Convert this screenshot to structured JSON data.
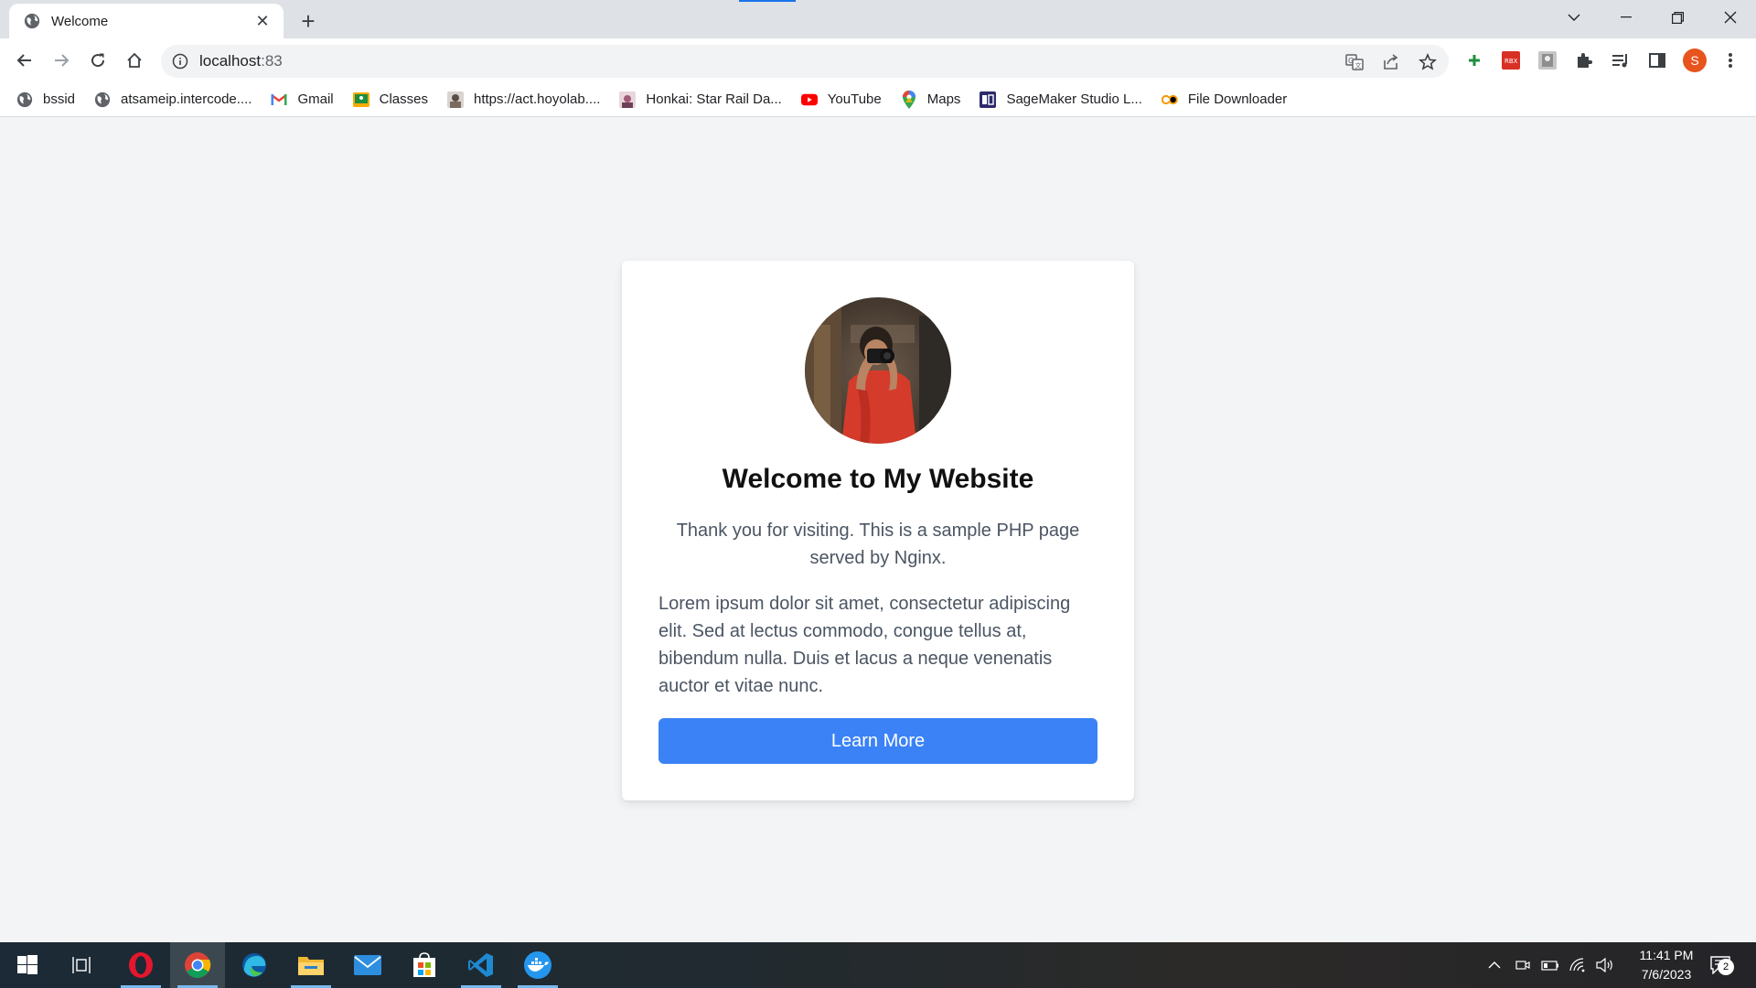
{
  "browser": {
    "tab": {
      "title": "Welcome",
      "favicon": "globe-icon"
    },
    "new_tab_label": "+",
    "address": {
      "host": "localhost",
      "port": ":83"
    },
    "profile_initial": "S"
  },
  "bookmarks": [
    {
      "label": "bssid",
      "icon": "globe-icon"
    },
    {
      "label": "atsameip.intercode....",
      "icon": "globe-icon"
    },
    {
      "label": "Gmail",
      "icon": "gmail-icon"
    },
    {
      "label": "Classes",
      "icon": "classroom-icon"
    },
    {
      "label": "https://act.hoyolab....",
      "icon": "hoyolab-icon"
    },
    {
      "label": "Honkai: Star Rail Da...",
      "icon": "honkai-icon"
    },
    {
      "label": "YouTube",
      "icon": "youtube-icon"
    },
    {
      "label": "Maps",
      "icon": "maps-icon"
    },
    {
      "label": "SageMaker Studio L...",
      "icon": "sagemaker-icon"
    },
    {
      "label": "File Downloader",
      "icon": "co-icon"
    }
  ],
  "card": {
    "title": "Welcome to My Website",
    "subtitle": "Thank you for visiting. This is a sample PHP page served by Nginx.",
    "body": "Lorem ipsum dolor sit amet, consectetur adipiscing elit. Sed at lectus commodo, congue tellus at, bibendum nulla. Duis et lacus a neque venenatis auctor et vitae nunc.",
    "button_label": "Learn More"
  },
  "taskbar": {
    "apps": [
      "windows-start-icon",
      "task-view-icon",
      "opera-icon",
      "chrome-icon",
      "edge-icon",
      "file-explorer-icon",
      "mail-icon",
      "store-icon",
      "vscode-icon",
      "docker-icon"
    ],
    "time": "11:41 PM",
    "date": "7/6/2023",
    "notification_count": "2"
  },
  "colors": {
    "accent": "#3b82f6",
    "page_background": "#f3f4f6",
    "profile": "#e8541e"
  }
}
